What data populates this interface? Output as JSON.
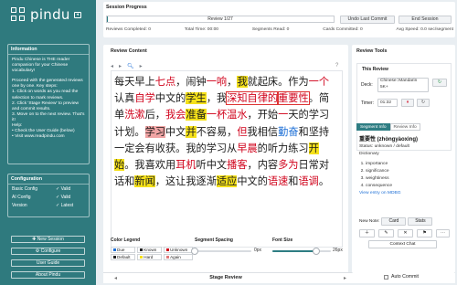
{
  "sidebar": {
    "logo_text": "pindu",
    "info_title": "Information",
    "info_paragraphs": [
      "Pindu Chinese is THE reader companion for your Chinese vocabulary!",
      "Proceed with the generated reviews one by one. Key steps:",
      "1. Click on words as you read the selection to mark reviews.",
      "2. Click 'Stage Review' to preview and commit results.",
      "3. Move on to the next review. That's it!"
    ],
    "help_title": "Help:",
    "help_lines": [
      "• Check the User Guide (below)",
      "• Visit www.readpindu.com"
    ],
    "config_title": "Configuration",
    "config_rows": [
      {
        "label": "Basic Config",
        "value": "✓ Valid"
      },
      {
        "label": "AI Config",
        "value": "✓ Valid"
      },
      {
        "label": "Version",
        "value": "✓ Latest"
      }
    ],
    "buttons": [
      "✚ New Session",
      "⚙ Configure",
      "User Guide",
      "About Pindu"
    ]
  },
  "session": {
    "title": "Session Progress",
    "progress_label": "Review 1/27",
    "progress_fraction": 0.003,
    "undo_label": "Undo Last Commit",
    "end_label": "End Session",
    "stats": [
      "Reviews Completed: 0",
      "Total Time: 00:00",
      "Segments Read: 0",
      "Cards Committed: 0",
      "Avg Speed: 0.0 sec/segment"
    ]
  },
  "review": {
    "title": "Review Content",
    "help_icon": "?",
    "tokens": [
      {
        "t": "每天早上",
        "c": ""
      },
      {
        "t": "七点",
        "c": "unk"
      },
      {
        "t": "，闹钟",
        "c": ""
      },
      {
        "t": "一响",
        "c": "unk"
      },
      {
        "t": "，",
        "c": ""
      },
      {
        "t": "我",
        "c": "hl-y"
      },
      {
        "t": "就起床。作为",
        "c": ""
      },
      {
        "t": "一个",
        "c": "unk"
      },
      {
        "t": "认真",
        "c": ""
      },
      {
        "t": "自学",
        "c": "unk"
      },
      {
        "t": "中文的",
        "c": ""
      },
      {
        "t": "学生",
        "c": "hl-y"
      },
      {
        "t": "，我",
        "c": ""
      },
      {
        "t": "深知自律的",
        "c": "unk bx"
      },
      {
        "t": "重要性",
        "c": "unk bx"
      },
      {
        "t": "。",
        "c": ""
      },
      {
        "t": "简单",
        "c": ""
      },
      {
        "t": "洗漱",
        "c": "unk"
      },
      {
        "t": "后，",
        "c": ""
      },
      {
        "t": "我会",
        "c": "unk"
      },
      {
        "t": "准备",
        "c": "hl-y"
      },
      {
        "t": "一杯",
        "c": "unk"
      },
      {
        "t": "温水",
        "c": "unk"
      },
      {
        "t": "，开始",
        "c": ""
      },
      {
        "t": "一",
        "c": "unk"
      },
      {
        "t": "天的",
        "c": ""
      },
      {
        "t": "学习计划",
        "c": ""
      },
      {
        "t": "。",
        "c": ""
      },
      {
        "t": "学习",
        "c": "hl-r"
      },
      {
        "t": "中文",
        "c": ""
      },
      {
        "t": "并",
        "c": "hl-y"
      },
      {
        "t": "不容易，",
        "c": ""
      },
      {
        "t": "但",
        "c": "unk"
      },
      {
        "t": "我相信",
        "c": ""
      },
      {
        "t": "勤奋",
        "c": "known"
      },
      {
        "t": "和",
        "c": ""
      },
      {
        "t": "坚持一定会有收获。我的学习从",
        "c": ""
      },
      {
        "t": "早晨",
        "c": "unk"
      },
      {
        "t": "的听力练习",
        "c": ""
      },
      {
        "t": "开始",
        "c": "hl-y"
      },
      {
        "t": "。我喜欢用",
        "c": ""
      },
      {
        "t": "耳机",
        "c": "unk"
      },
      {
        "t": "听中文",
        "c": ""
      },
      {
        "t": "播客",
        "c": "unk"
      },
      {
        "t": "，内容",
        "c": ""
      },
      {
        "t": "多为",
        "c": "unk"
      },
      {
        "t": "日常",
        "c": ""
      },
      {
        "t": "对话和",
        "c": ""
      },
      {
        "t": "新闻",
        "c": "hl-y"
      },
      {
        "t": "，这让我逐渐",
        "c": ""
      },
      {
        "t": "适应",
        "c": "hl-y"
      },
      {
        "t": "中文的",
        "c": ""
      },
      {
        "t": "语速",
        "c": "unk"
      },
      {
        "t": "和",
        "c": ""
      },
      {
        "t": "语调",
        "c": "unk"
      },
      {
        "t": "。",
        "c": ""
      }
    ],
    "legend_title": "Color Legend",
    "legend": [
      {
        "label": "Due",
        "color": "#1d6fd6"
      },
      {
        "label": "Known",
        "color": "#222222"
      },
      {
        "label": "Unknown",
        "color": "#d0021b"
      },
      {
        "label": "Default",
        "color": "#222222"
      },
      {
        "label": "Hard",
        "color": "#f5e11a"
      },
      {
        "label": "Again",
        "color": "#e07a7a"
      }
    ],
    "segment_spacing_title": "Segment Spacing",
    "segment_spacing_value": "0px",
    "segment_spacing_fraction": 0.0,
    "font_size_title": "Font Size",
    "font_size_value": "26px",
    "font_size_fraction": 0.75
  },
  "stage": {
    "label": "Stage Review",
    "prev": "◂",
    "next": "▸",
    "autocommit": "Auto Commit"
  },
  "tools": {
    "title": "Review Tools",
    "this_review": "This Review",
    "deck_label": "Deck:",
    "deck_value": "Chinese::Mandarin 5K+",
    "timer_label": "Timer:",
    "timer_value": "01:32",
    "tabs": [
      "Segment Info",
      "Review Info"
    ],
    "word": "重要性 (zhòngyàoxìng)",
    "status": "Status: unknown / default",
    "dictionary_label": "Dictionary",
    "definitions": [
      "importance",
      "significance",
      "weightiness",
      "consequence"
    ],
    "mdbg_link": "View entry on MDBG",
    "new_note_label": "New Note:",
    "card_btn": "Card",
    "stats_btn": "Stats",
    "context_btn": "Context Chat"
  }
}
